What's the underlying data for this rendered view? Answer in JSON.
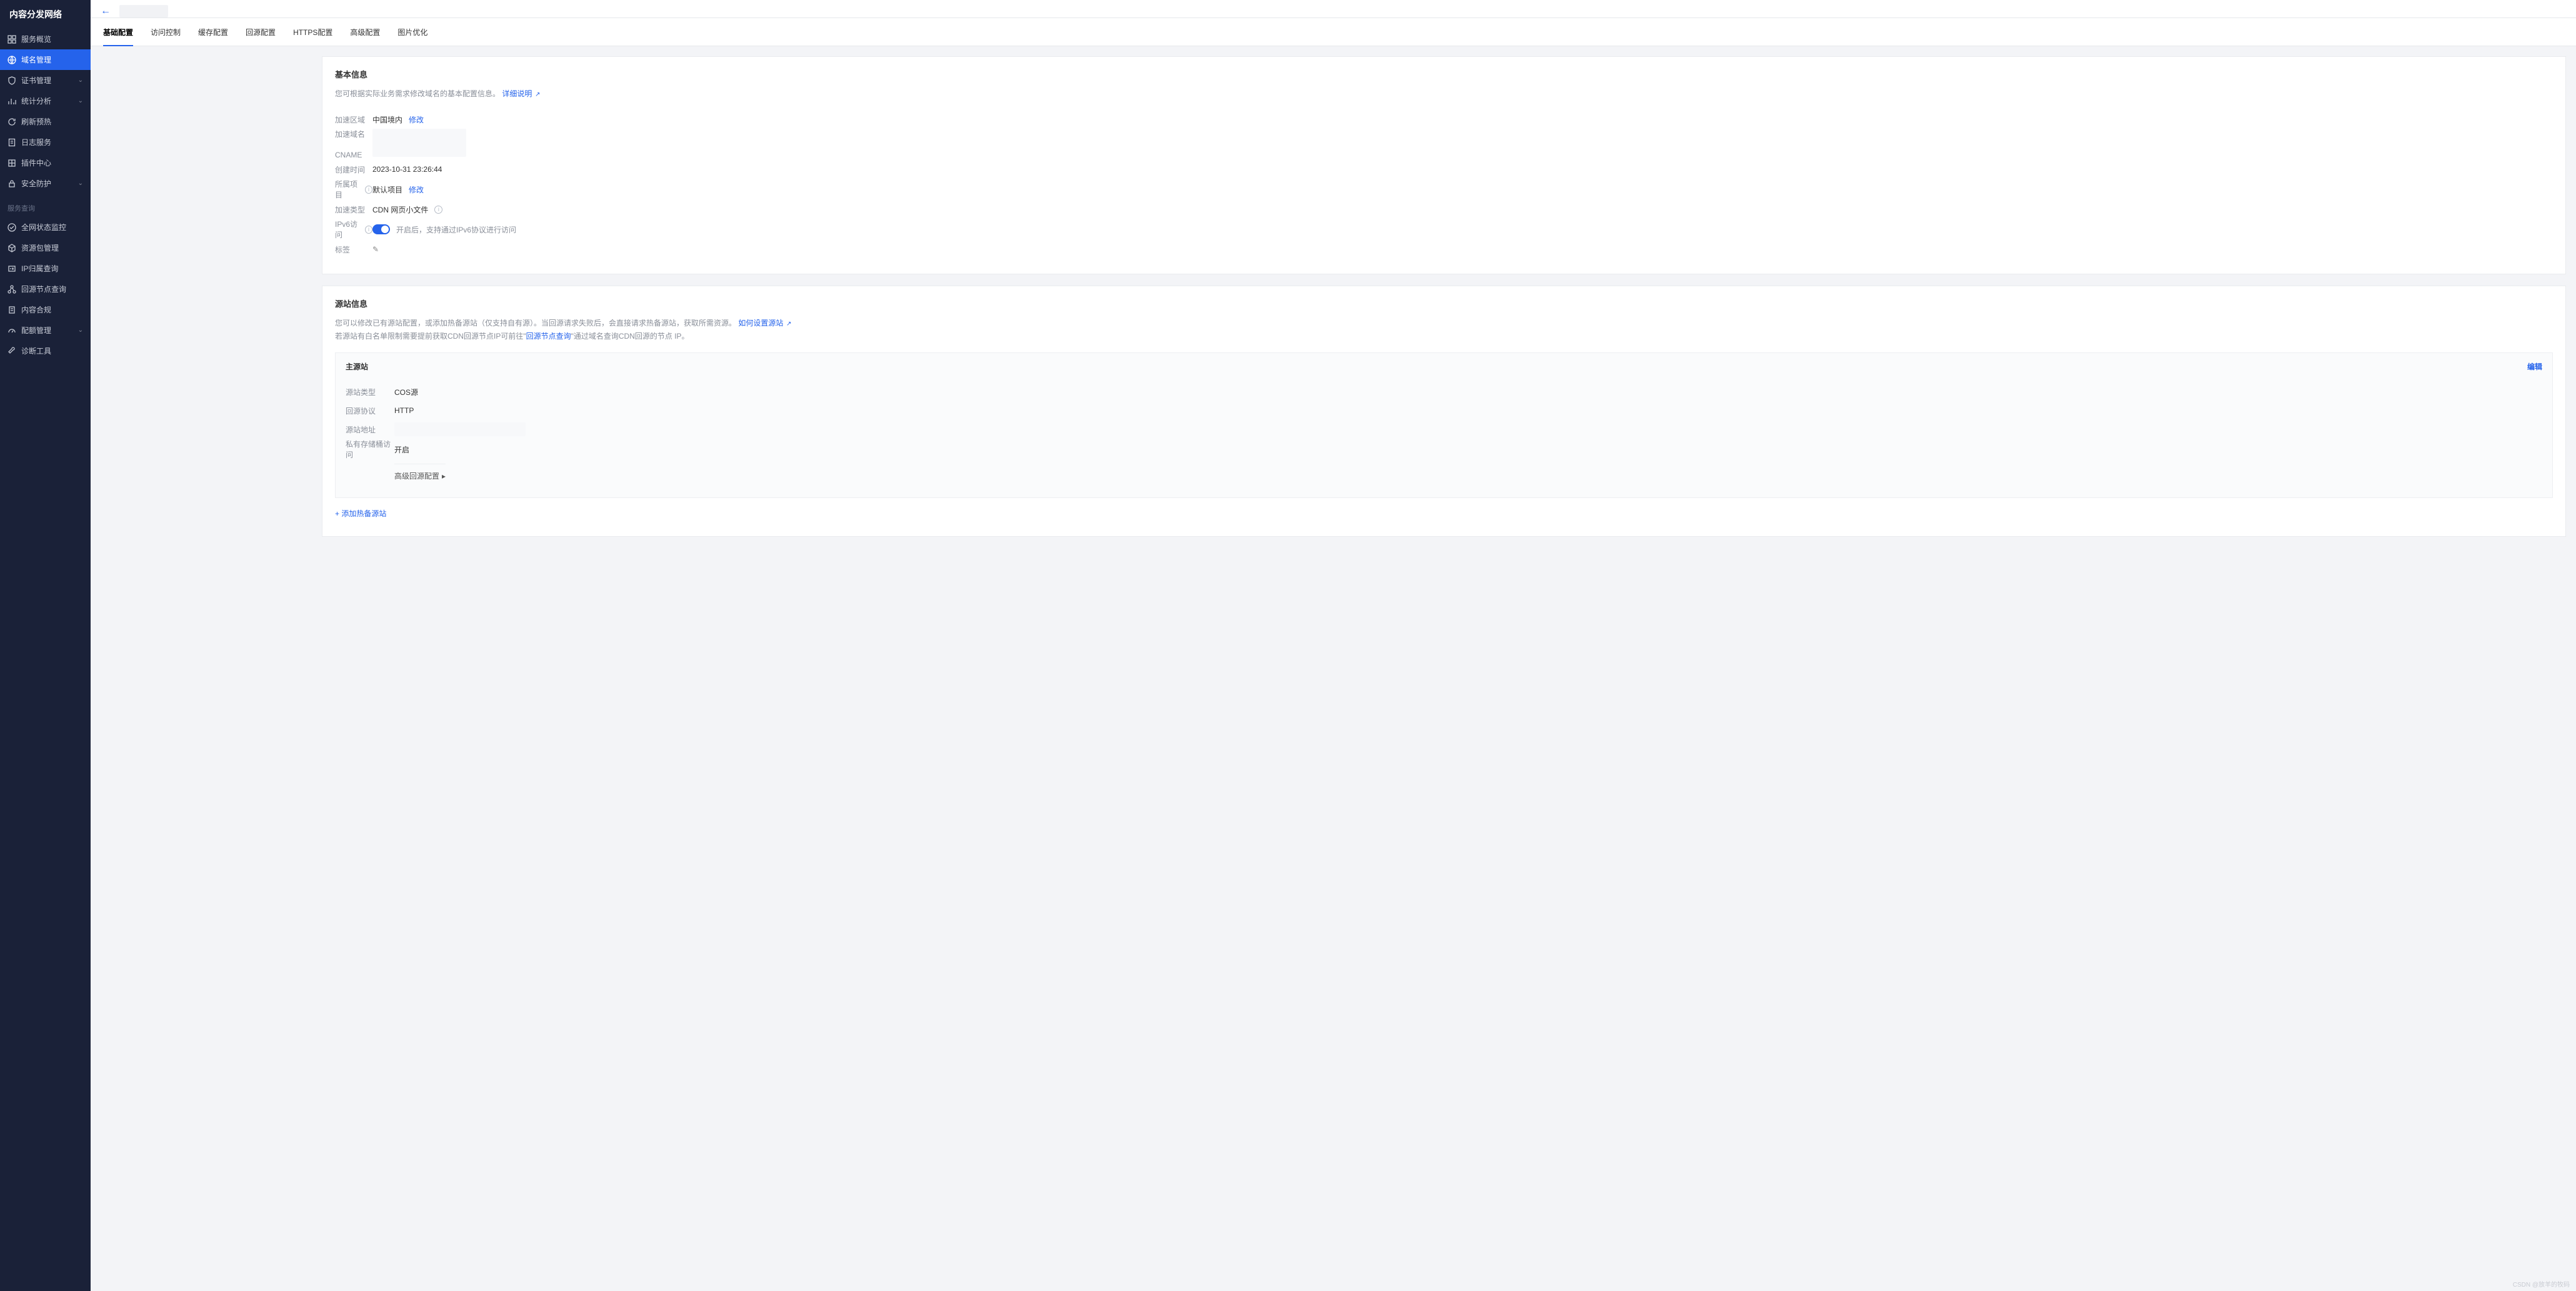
{
  "sidebar": {
    "title": "内容分发网络",
    "items": [
      {
        "label": "服务概览"
      },
      {
        "label": "域名管理",
        "active": true
      },
      {
        "label": "证书管理",
        "expandable": true
      },
      {
        "label": "统计分析",
        "expandable": true
      },
      {
        "label": "刷新预热"
      },
      {
        "label": "日志服务"
      },
      {
        "label": "插件中心"
      },
      {
        "label": "安全防护",
        "expandable": true
      }
    ],
    "group2_label": "服务查询",
    "items2": [
      {
        "label": "全网状态监控"
      },
      {
        "label": "资源包管理"
      },
      {
        "label": "IP归属查询"
      },
      {
        "label": "回源节点查询"
      },
      {
        "label": "内容合规"
      },
      {
        "label": "配额管理",
        "expandable": true
      },
      {
        "label": "诊断工具"
      }
    ]
  },
  "tabs": [
    "基础配置",
    "访问控制",
    "缓存配置",
    "回源配置",
    "HTTPS配置",
    "高级配置",
    "图片优化"
  ],
  "basic_info": {
    "title": "基本信息",
    "desc": "您可根据实际业务需求修改域名的基本配置信息。",
    "desc_link": "详细说明",
    "fields": {
      "region_label": "加速区域",
      "region_value": "中国境内",
      "region_modify": "修改",
      "domain_label": "加速域名",
      "cname_label": "CNAME",
      "created_label": "创建时间",
      "created_value": "2023-10-31 23:26:44",
      "project_label": "所属项目",
      "project_value": "默认项目",
      "project_modify": "修改",
      "accel_type_label": "加速类型",
      "accel_type_value": "CDN 网页小文件",
      "ipv6_label": "IPv6访问",
      "ipv6_hint": "开启后，支持通过IPv6协议进行访问",
      "tag_label": "标签"
    }
  },
  "origin_info": {
    "title": "源站信息",
    "desc1_a": "您可以修改已有源站配置，或添加热备源站（仅支持自有源）。当回源请求失败后，会直接请求热备源站，获取所需资源。",
    "desc1_link": "如何设置源站",
    "desc2_a": "若源站有白名单限制需要提前获取CDN回源节点IP可前往\"",
    "desc2_link": "回源节点查询",
    "desc2_b": "\"通过域名查询CDN回源的节点 IP。",
    "primary_title": "主源站",
    "edit": "编辑",
    "origin_type_label": "源站类型",
    "origin_type_value": "COS源",
    "origin_proto_label": "回源协议",
    "origin_proto_value": "HTTP",
    "origin_addr_label": "源站地址",
    "bucket_label": "私有存储桶访问",
    "bucket_value": "开启",
    "expander": "高级回源配置",
    "add_backup": "+ 添加热备源站"
  },
  "watermark": "CSDN @放羊的牧码"
}
